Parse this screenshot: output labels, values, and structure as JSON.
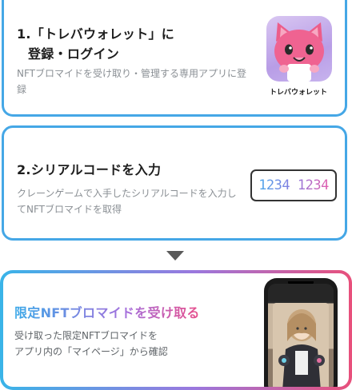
{
  "steps": [
    {
      "title_line1": "1.「トレバウォレット」に",
      "title_line2": "登録・ログイン",
      "description": "NFTブロマイドを受け取り・管理する専用アプリに登録",
      "app_name": "トレバウォレット"
    },
    {
      "title": "2.シリアルコードを入力",
      "description": "クレーンゲームで入手したシリアルコードを入力してNFTブロマイドを取得",
      "serial_example": "1234 1234"
    },
    {
      "title": "限定NFTブロマイドを受け取る",
      "description_line1": "受け取った限定NFTブロマイドを",
      "description_line2": "アプリ内の「マイページ」から確認"
    }
  ],
  "colors": {
    "card_border": "#45a7e6",
    "gradient_start": "#39b4e8",
    "gradient_mid": "#9a78de",
    "gradient_end": "#e8507b"
  },
  "icons": [
    "cat-app-icon",
    "down-arrow-icon",
    "phone-mockup"
  ]
}
